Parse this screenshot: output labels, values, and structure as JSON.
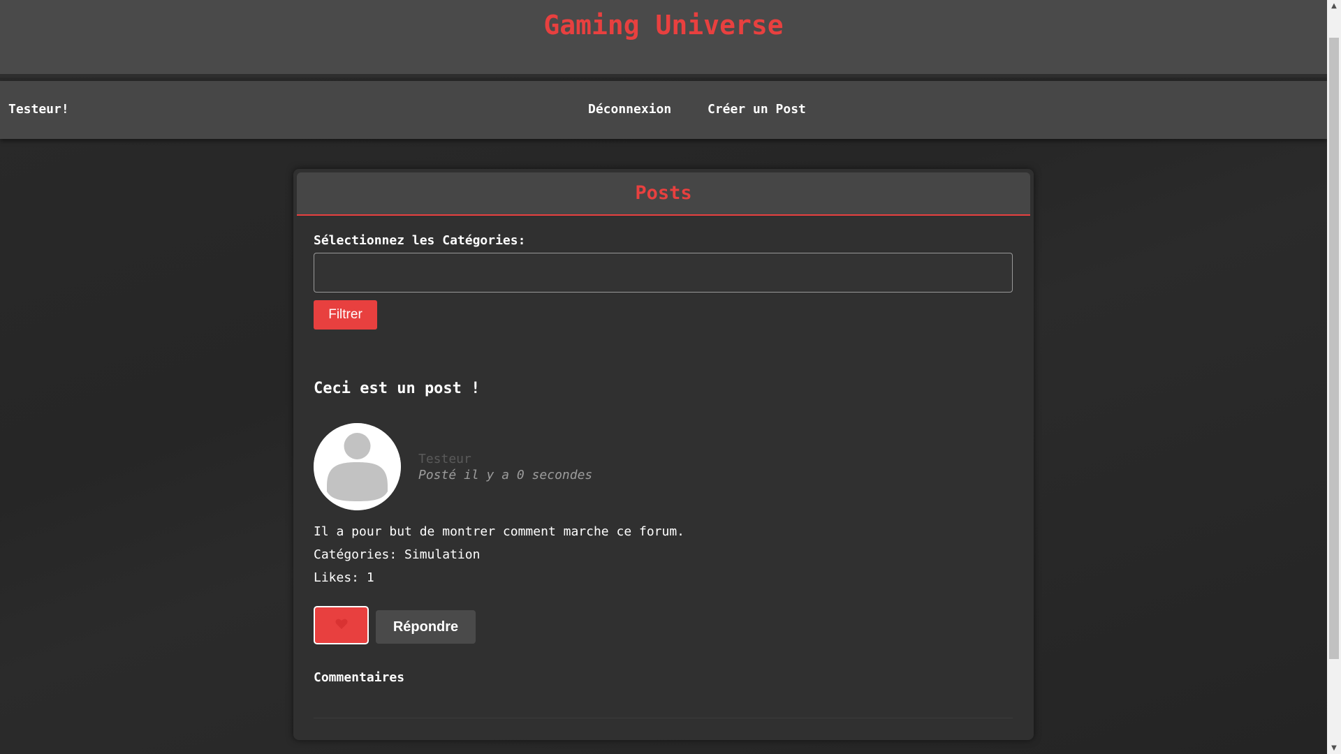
{
  "site": {
    "title": "Gaming Universe"
  },
  "navbar": {
    "user_greeting": "Testeur!",
    "logout_label": "Déconnexion",
    "create_post_label": "Créer un Post"
  },
  "posts_card": {
    "title": "Posts",
    "filter_label": "Sélectionnez les Catégories:",
    "category_select_value": "",
    "filter_button_label": "Filtrer"
  },
  "post": {
    "title": "Ceci est un post !",
    "author": "Testeur",
    "time": "Posté il y a 0 secondes",
    "body": "Il a pour but de montrer comment marche ce forum.",
    "categories": "Catégories: Simulation",
    "likes": "Likes: 1",
    "avatar_icon": "user-avatar-icon",
    "like_icon": "heart-icon",
    "reply_label": "Répondre",
    "comments_heading": "Commentaires"
  },
  "colors": {
    "accent": "#e8403f",
    "header_bg": "#4a4a4a",
    "page_bg": "#272727",
    "card_bg": "#303030"
  }
}
